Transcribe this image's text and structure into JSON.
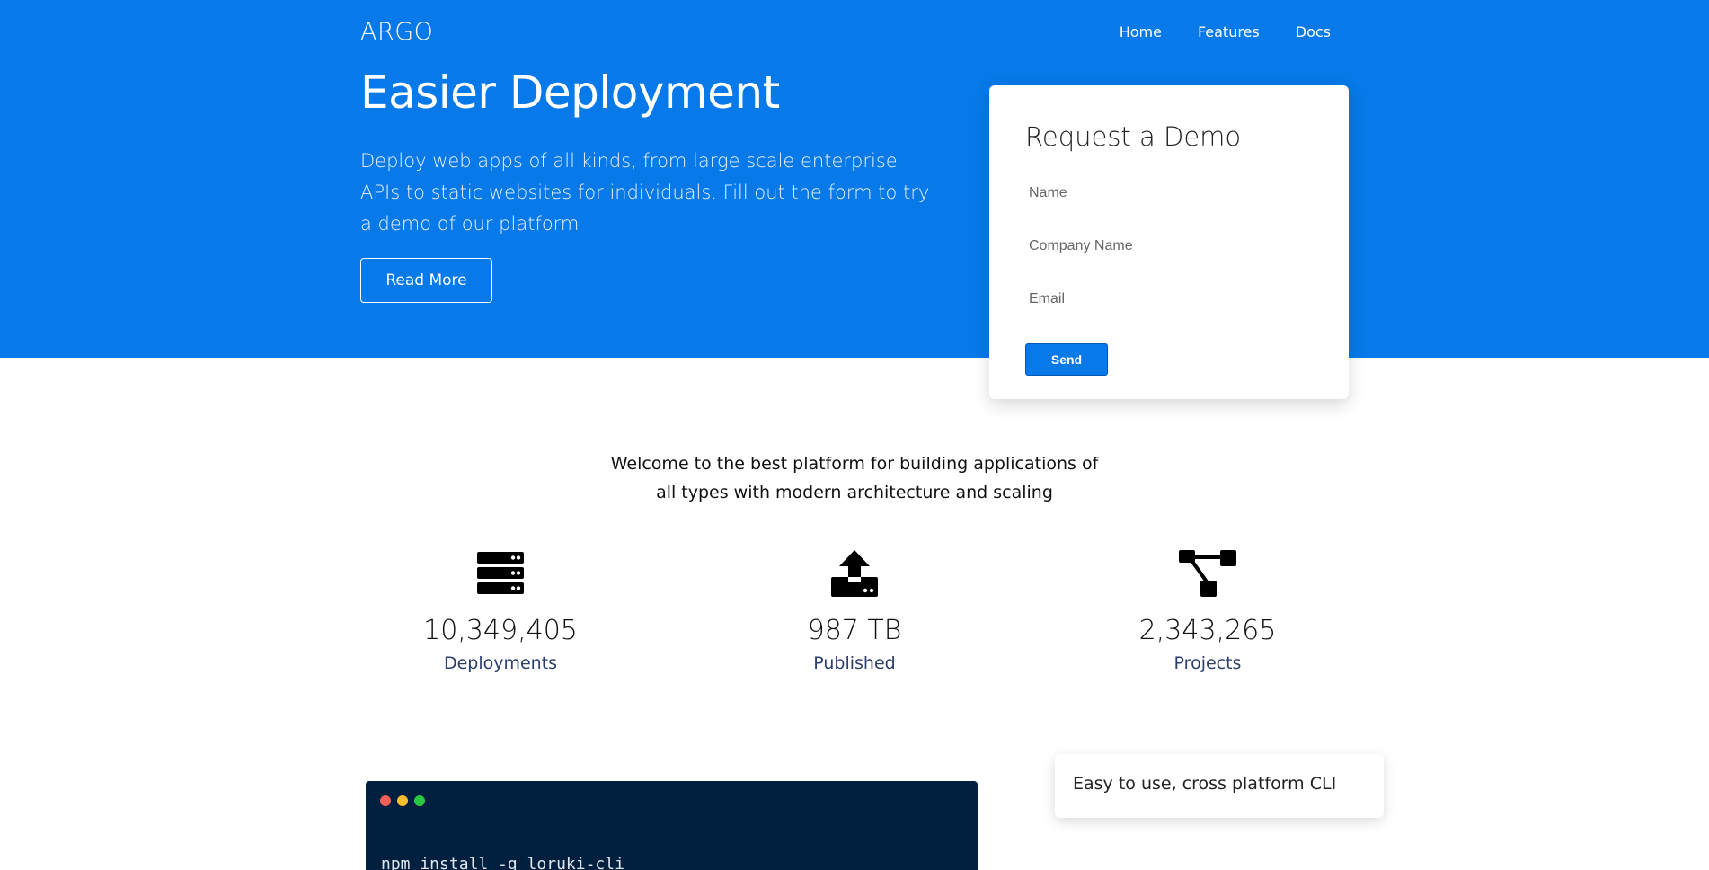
{
  "brand": "ARGO",
  "nav": {
    "home": "Home",
    "features": "Features",
    "docs": "Docs"
  },
  "hero": {
    "title": "Easier Deployment",
    "description": "Deploy web apps of all kinds, from large scale enterprise APIs to static websites for individuals. Fill out the form to try a demo of our platform",
    "read_more": "Read More",
    "background_color": "#0779e8"
  },
  "demo_form": {
    "title": "Request a Demo",
    "name_placeholder": "Name",
    "company_placeholder": "Company Name",
    "email_placeholder": "Email",
    "send_label": "Send"
  },
  "welcome": {
    "line1": "Welcome to the best platform for building applications of",
    "line2": "all types with modern architecture and scaling"
  },
  "stats": [
    {
      "icon": "server-icon",
      "value": "10,349,405",
      "label": "Deployments"
    },
    {
      "icon": "upload-icon",
      "value": "987 TB",
      "label": "Published"
    },
    {
      "icon": "project-diagram-icon",
      "value": "2,343,265",
      "label": "Projects"
    }
  ],
  "terminal": {
    "command": "npm install -g loruki-cli",
    "dot_colors": [
      "#f35f57",
      "#f9bd2e",
      "#2ac840"
    ]
  },
  "cli_card": {
    "text": "Easy to use, cross platform CLI"
  }
}
